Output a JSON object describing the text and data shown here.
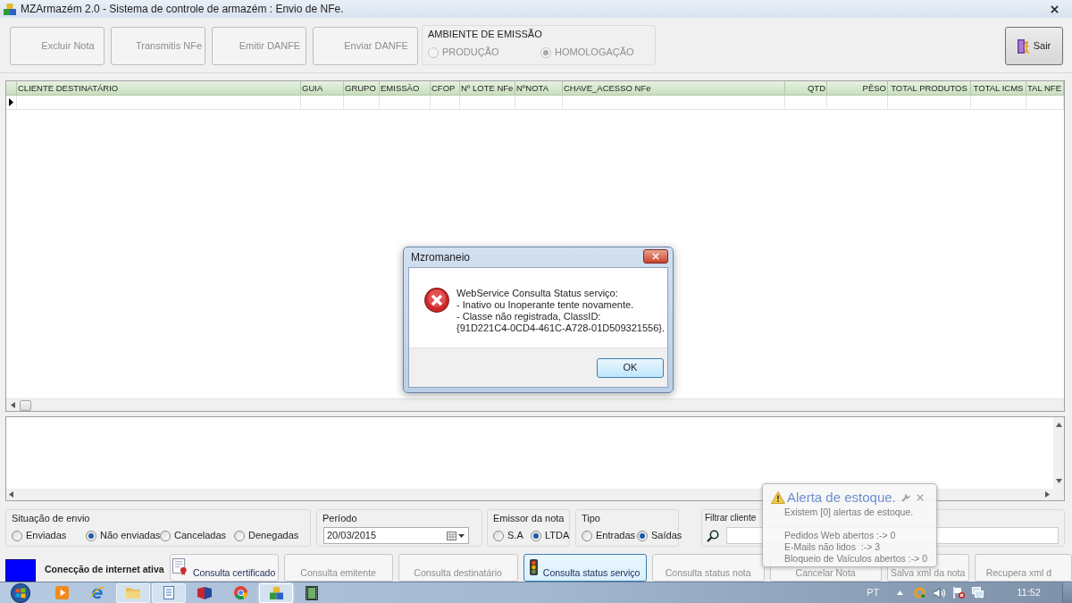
{
  "window": {
    "title": "MZArmazém 2.0 - Sistema de controle de armazém : Envio de NFe."
  },
  "toolbar": {
    "buttons": [
      {
        "label": "Excluir Nota",
        "disabled": true
      },
      {
        "label": "Transmitis NFe",
        "disabled": true
      },
      {
        "label": "Emitir DANFE",
        "disabled": true
      },
      {
        "label": "Enviar DANFE",
        "disabled": true
      }
    ],
    "environment": {
      "title": "AMBIENTE DE EMISSÃO",
      "options": [
        {
          "label": "PRODUÇÃO",
          "selected": false,
          "disabled": true
        },
        {
          "label": "HOMOLOGAÇÃO",
          "selected": true,
          "disabled": true
        }
      ]
    },
    "exit_button": {
      "label": "Sair"
    }
  },
  "grid": {
    "columns": [
      "CLIENTE DESTINATÁRIO",
      "GUIA",
      "GRUPO",
      "EMISSÃO",
      "CFOP",
      "Nº LOTE NFe",
      "NºNOTA",
      "CHAVE_ACESSO NFe",
      "QTD",
      "PÊSO",
      "TOTAL PRODUTOS",
      "TOTAL ICMS",
      "TAL NFE"
    ],
    "rows": [
      {
        "current": true
      }
    ]
  },
  "filters": {
    "status": {
      "title": "Situação de envio",
      "options": [
        {
          "label": "Enviadas",
          "selected": false
        },
        {
          "label": "Não enviadas",
          "selected": true
        },
        {
          "label": "Canceladas",
          "selected": false
        },
        {
          "label": "Denegadas",
          "selected": false
        }
      ]
    },
    "period": {
      "title": "Período",
      "value": "20/03/2015"
    },
    "issuer": {
      "title": "Emissor da nota",
      "options": [
        {
          "label": "S.A",
          "selected": false
        },
        {
          "label": "LTDA",
          "selected": true
        }
      ]
    },
    "type": {
      "title": "Tipo",
      "options": [
        {
          "label": "Entradas",
          "selected": false
        },
        {
          "label": "Saídas",
          "selected": true
        }
      ]
    },
    "client_filter": {
      "title": "Filtrar cliente"
    }
  },
  "bottom_bar": {
    "connection": {
      "label": "Conecção de internet ativa",
      "active": true
    },
    "buttons": [
      {
        "label": "Consulta certificado",
        "disabled": false,
        "focused": false
      },
      {
        "label": "Consulta emitente",
        "disabled": true,
        "focused": false
      },
      {
        "label": "Consulta destinatário",
        "disabled": true,
        "focused": false
      },
      {
        "label": "Consulta status serviço",
        "disabled": false,
        "focused": true
      },
      {
        "label": "Consulta status nota",
        "disabled": true,
        "focused": false
      },
      {
        "label": "Cancelar Nota",
        "disabled": true,
        "focused": false
      },
      {
        "label": "Salva xml da nota",
        "disabled": true,
        "focused": false
      },
      {
        "label": "Recupera xml d",
        "disabled": true,
        "focused": false
      }
    ]
  },
  "stock_alert": {
    "title": "Alerta de estoque.",
    "summary": "Existem [0] alertas de estoque.",
    "counters": [
      "Pedidos Web abertos :-> 0",
      "E-Mails não lidos  :-> 3",
      "Bloqueio de Vaículos abertos :-> 0"
    ]
  },
  "dialog": {
    "title": "Mzromaneio",
    "message": "WebService Consulta Status serviço:\n- Inativo ou Inoperante tente novamente.\n- Classe não registrada, ClassID:\n{91D221C4-0CD4-461C-A728-01D509321556}.",
    "button": "OK"
  },
  "taskbar": {
    "items": [
      {
        "running": false,
        "selected": false
      },
      {
        "running": false,
        "selected": false
      },
      {
        "running": true,
        "selected": false
      },
      {
        "running": true,
        "selected": false
      },
      {
        "running": false,
        "selected": false
      },
      {
        "running": false,
        "selected": false
      },
      {
        "running": true,
        "selected": true
      },
      {
        "running": false,
        "selected": false
      }
    ],
    "language": "PT",
    "clock": "11:52"
  }
}
